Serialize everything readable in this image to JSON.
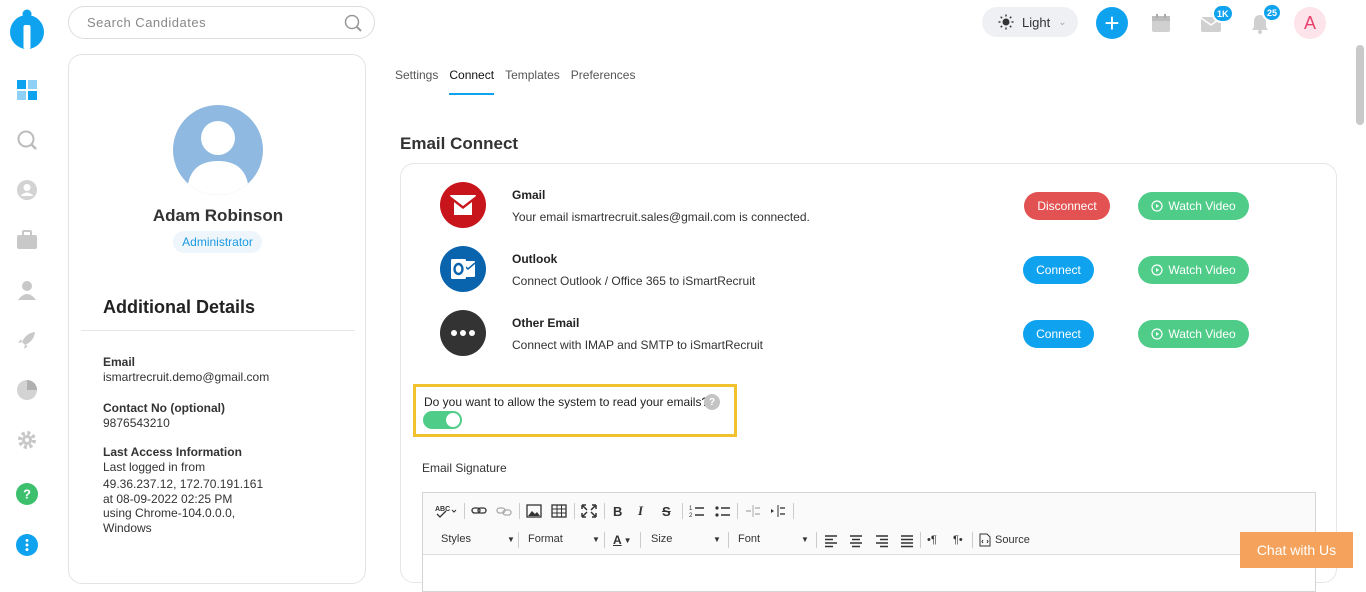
{
  "header": {
    "search_placeholder": "Search Candidates",
    "theme_label": "Light",
    "email_badge": "1K",
    "notification_badge": "25",
    "user_initial": "A"
  },
  "profile": {
    "name": "Adam Robinson",
    "role": "Administrator",
    "additional_details_title": "Additional Details",
    "email_label": "Email",
    "email_value": "ismartrecruit.demo@gmail.com",
    "contact_label": "Contact No (optional)",
    "contact_value": "9876543210",
    "last_access_label": "Last Access Information",
    "last_access_line1": "Last logged in from",
    "last_access_line2": "49.36.237.12, 172.70.191.161",
    "last_access_line3": "at 08-09-2022 02:25 PM",
    "last_access_line4": "using Chrome-104.0.0.0,",
    "last_access_line5": "Windows"
  },
  "tabs": [
    {
      "label": "Settings"
    },
    {
      "label": "Connect"
    },
    {
      "label": "Templates"
    },
    {
      "label": "Preferences"
    }
  ],
  "email_connect": {
    "title": "Email Connect",
    "providers": [
      {
        "name": "Gmail",
        "desc": "Your email ismartrecruit.sales@gmail.com is connected.",
        "action": "Disconnect",
        "video": "Watch Video"
      },
      {
        "name": "Outlook",
        "desc": "Connect Outlook / Office 365 to iSmartRecruit",
        "action": "Connect",
        "video": "Watch Video"
      },
      {
        "name": "Other Email",
        "desc": "Connect with IMAP and SMTP to iSmartRecruit",
        "action": "Connect",
        "video": "Watch Video"
      }
    ],
    "allow_question": "Do you want to allow the system to read your emails?",
    "help_glyph": "?",
    "signature_label": "Email Signature"
  },
  "editor": {
    "styles": "Styles",
    "format": "Format",
    "size": "Size",
    "font": "Font",
    "source": "Source"
  },
  "chat_label": "Chat with Us",
  "colors": {
    "accent": "#0fa3ef",
    "disconnect": "#e35253",
    "video": "#4fcc88",
    "highlight": "#f2c12e",
    "chat": "#f5a35c"
  }
}
